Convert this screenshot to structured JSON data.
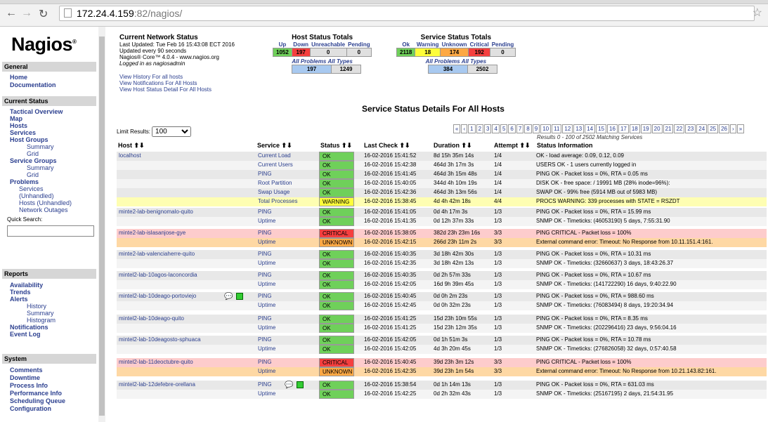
{
  "browser": {
    "url_host": "172.24.4.159",
    "url_path": ":82/nagios/"
  },
  "sidebar": {
    "logo": "Nagios",
    "sections": [
      {
        "title": "General",
        "items": [
          {
            "label": "Home"
          },
          {
            "label": "Documentation"
          }
        ]
      },
      {
        "title": "Current Status"
      },
      {
        "title": "Reports"
      },
      {
        "title": "System"
      }
    ],
    "current_status": [
      "Tactical Overview",
      "Map",
      "Hosts",
      "Services",
      "Host Groups",
      "Summary",
      "Grid",
      "Service Groups",
      "Summary",
      "Grid",
      "Problems",
      "Services",
      "(Unhandled)",
      "Hosts (Unhandled)",
      "Network Outages"
    ],
    "quick_search": "Quick Search:",
    "reports": [
      "Availability",
      "Trends",
      "Alerts",
      "History",
      "Summary",
      "Histogram",
      "Notifications",
      "Event Log"
    ],
    "system": [
      "Comments",
      "Downtime",
      "Process Info",
      "Performance Info",
      "Scheduling Queue",
      "Configuration"
    ]
  },
  "status_info": {
    "title": "Current Network Status",
    "lines": [
      "Last Updated: Tue Feb 16 15:43:08 ECT 2016",
      "Updated every 90 seconds",
      "Nagios® Core™ 4.0.4 - www.nagios.org",
      "Logged in as nagiosadmin"
    ],
    "links": [
      "View History For all hosts",
      "View Notifications For All Hosts",
      "View Host Status Detail For All Hosts"
    ]
  },
  "host_totals": {
    "title": "Host Status Totals",
    "headers": [
      "Up",
      "Down",
      "Unreachable",
      "Pending"
    ],
    "values": [
      "1052",
      "197",
      "0",
      "0"
    ],
    "all_problems": "All Problems",
    "all_types": "All Types",
    "problems": "197",
    "types": "1249"
  },
  "service_totals": {
    "title": "Service Status Totals",
    "headers": [
      "Ok",
      "Warning",
      "Unknown",
      "Critical",
      "Pending"
    ],
    "values": [
      "2118",
      "18",
      "174",
      "192",
      "0"
    ],
    "all_problems": "All Problems",
    "all_types": "All Types",
    "problems": "384",
    "types": "2502"
  },
  "details_title": "Service Status Details For All Hosts",
  "limit": {
    "label": "Limit Results:",
    "value": "100"
  },
  "pager": [
    "«",
    "‹",
    "1",
    "2",
    "3",
    "4",
    "5",
    "6",
    "7",
    "8",
    "9",
    "10",
    "11",
    "12",
    "13",
    "14",
    "15",
    "16",
    "17",
    "18",
    "19",
    "20",
    "21",
    "22",
    "23",
    "24",
    "25",
    "26",
    "›",
    "»"
  ],
  "results_text": "Results 0 - 100 of 2502 Matching Services",
  "columns": [
    "Host ⬆⬇",
    "Service ⬆⬇",
    "Status ⬆⬇",
    "Last Check ⬆⬇",
    "Duration ⬆⬇",
    "Attempt ⬆⬇",
    "Status Information"
  ],
  "rows": [
    {
      "host": "localhost",
      "service": "Current Load",
      "status": "OK",
      "last": "16-02-2016 15:41:52",
      "dur": "8d 15h 35m 14s",
      "att": "1/4",
      "info": "OK - load average: 0.09, 0.12, 0.09"
    },
    {
      "host": "",
      "service": "Current Users",
      "status": "OK",
      "last": "16-02-2016 15:42:38",
      "dur": "464d 3h 17m 3s",
      "att": "1/4",
      "info": "USERS OK - 1 users currently logged in"
    },
    {
      "host": "",
      "service": "PING",
      "status": "OK",
      "last": "16-02-2016 15:41:45",
      "dur": "464d 3h 15m 48s",
      "att": "1/4",
      "info": "PING OK - Packet loss = 0%, RTA = 0.05 ms"
    },
    {
      "host": "",
      "service": "Root Partition",
      "status": "OK",
      "last": "16-02-2016 15:40:05",
      "dur": "344d 4h 10m 19s",
      "att": "1/4",
      "info": "DISK OK - free space: / 19991 MB (28% inode=96%):"
    },
    {
      "host": "",
      "service": "Swap Usage",
      "status": "OK",
      "last": "16-02-2016 15:42:36",
      "dur": "464d 3h 13m 56s",
      "att": "1/4",
      "info": "SWAP OK - 99% free (5914 MB out of 5983 MB)"
    },
    {
      "host": "",
      "service": "Total Processes",
      "status": "WARNING",
      "last": "16-02-2016 15:38:45",
      "dur": "4d 4h 42m 18s",
      "att": "4/4",
      "info": "PROCS WARNING: 339 processes with STATE = RSZDT"
    },
    {
      "host": "minte2-lab-benignomalo-quito",
      "service": "PING",
      "status": "OK",
      "last": "16-02-2016 15:41:05",
      "dur": "0d 4h 17m 3s",
      "att": "1/3",
      "info": "PING OK - Packet loss = 0%, RTA = 15.99 ms"
    },
    {
      "host": "",
      "service": "Uptime",
      "status": "OK",
      "last": "16-02-2016 15:41:35",
      "dur": "0d 12h 37m 33s",
      "att": "1/3",
      "info": "SNMP OK - Timeticks: (46053190) 5 days, 7:55:31.90"
    },
    {
      "host": "minte2-lab-islasanjose-gye",
      "service": "PING",
      "status": "CRITICAL",
      "last": "16-02-2016 15:38:05",
      "dur": "382d 23h 23m 16s",
      "att": "3/3",
      "info": "PING CRITICAL - Packet loss = 100%"
    },
    {
      "host": "",
      "service": "Uptime",
      "status": "UNKNOWN",
      "last": "16-02-2016 15:42:15",
      "dur": "266d 23h 11m 2s",
      "att": "3/3",
      "info": "External command error: Timeout: No Response from 10.11.151.4:161."
    },
    {
      "host": "minte2-lab-valenciaherre-quito",
      "service": "PING",
      "status": "OK",
      "last": "16-02-2016 15:40:35",
      "dur": "3d 18h 42m 30s",
      "att": "1/3",
      "info": "PING OK - Packet loss = 0%, RTA = 10.31 ms"
    },
    {
      "host": "",
      "service": "Uptime",
      "status": "OK",
      "last": "16-02-2016 15:42:35",
      "dur": "3d 18h 42m 13s",
      "att": "1/3",
      "info": "SNMP OK - Timeticks: (32660637) 3 days, 18:43:26.37"
    },
    {
      "host": "mintel2-lab-10agos-laconcordia",
      "service": "PING",
      "status": "OK",
      "last": "16-02-2016 15:40:35",
      "dur": "0d 2h 57m 33s",
      "att": "1/3",
      "info": "PING OK - Packet loss = 0%, RTA = 10.67 ms"
    },
    {
      "host": "",
      "service": "Uptime",
      "status": "OK",
      "last": "16-02-2016 15:42:05",
      "dur": "16d 9h 39m 45s",
      "att": "1/3",
      "info": "SNMP OK - Timeticks: (141722290) 16 days, 9:40:22.90"
    },
    {
      "host": "mintel2-lab-10deago-portoviejo",
      "service": "PING",
      "status": "OK",
      "last": "16-02-2016 15:40:45",
      "dur": "0d 0h 2m 23s",
      "att": "1/3",
      "info": "PING OK - Packet loss = 0%, RTA = 988.60 ms"
    },
    {
      "host": "",
      "service": "Uptime",
      "status": "OK",
      "last": "16-02-2016 15:42:45",
      "dur": "0d 0h 32m 23s",
      "att": "1/3",
      "info": "SNMP OK - Timeticks: (76083494) 8 days, 19:20:34.94"
    },
    {
      "host": "mintel2-lab-10deago-quito",
      "service": "PING",
      "status": "OK",
      "last": "16-02-2016 15:41:25",
      "dur": "15d 23h 10m 55s",
      "att": "1/3",
      "info": "PING OK - Packet loss = 0%, RTA = 8.35 ms"
    },
    {
      "host": "",
      "service": "Uptime",
      "status": "OK",
      "last": "16-02-2016 15:41:25",
      "dur": "15d 23h 12m 35s",
      "att": "1/3",
      "info": "SNMP OK - Timeticks: (202296416) 23 days, 9:56:04.16"
    },
    {
      "host": "mintel2-lab-10deagosto-sphuaca",
      "service": "PING",
      "status": "OK",
      "last": "16-02-2016 15:42:05",
      "dur": "0d 1h 51m 3s",
      "att": "1/3",
      "info": "PING OK - Packet loss = 0%, RTA = 10.78 ms"
    },
    {
      "host": "",
      "service": "Uptime",
      "status": "OK",
      "last": "16-02-2016 15:42:05",
      "dur": "4d 3h 20m 45s",
      "att": "1/3",
      "info": "SNMP OK - Timeticks: (276826058) 32 days, 0:57:40.58"
    },
    {
      "host": "mintel2-lab-11deoctubre-quito",
      "service": "PING",
      "status": "CRITICAL",
      "last": "16-02-2016 15:40:45",
      "dur": "39d 23h 3m 12s",
      "att": "3/3",
      "info": "PING CRITICAL - Packet loss = 100%"
    },
    {
      "host": "",
      "service": "Uptime",
      "status": "UNKNOWN",
      "last": "16-02-2016 15:42:35",
      "dur": "39d 23h 1m 54s",
      "att": "3/3",
      "info": "External command error: Timeout: No Response from 10.21.143.82:161."
    },
    {
      "host": "mintel2-lab-12defebre-orellana",
      "service": "PING",
      "status": "OK",
      "last": "16-02-2016 15:38:54",
      "dur": "0d 1h 14m 13s",
      "att": "1/3",
      "info": "PING OK - Packet loss = 0%, RTA = 631.03 ms"
    },
    {
      "host": "",
      "service": "Uptime",
      "status": "OK",
      "last": "16-02-2016 15:42:25",
      "dur": "0d 2h 32m 43s",
      "att": "1/3",
      "info": "SNMP OK - Timeticks: (25167195) 2 days, 21:54:31.95"
    }
  ]
}
